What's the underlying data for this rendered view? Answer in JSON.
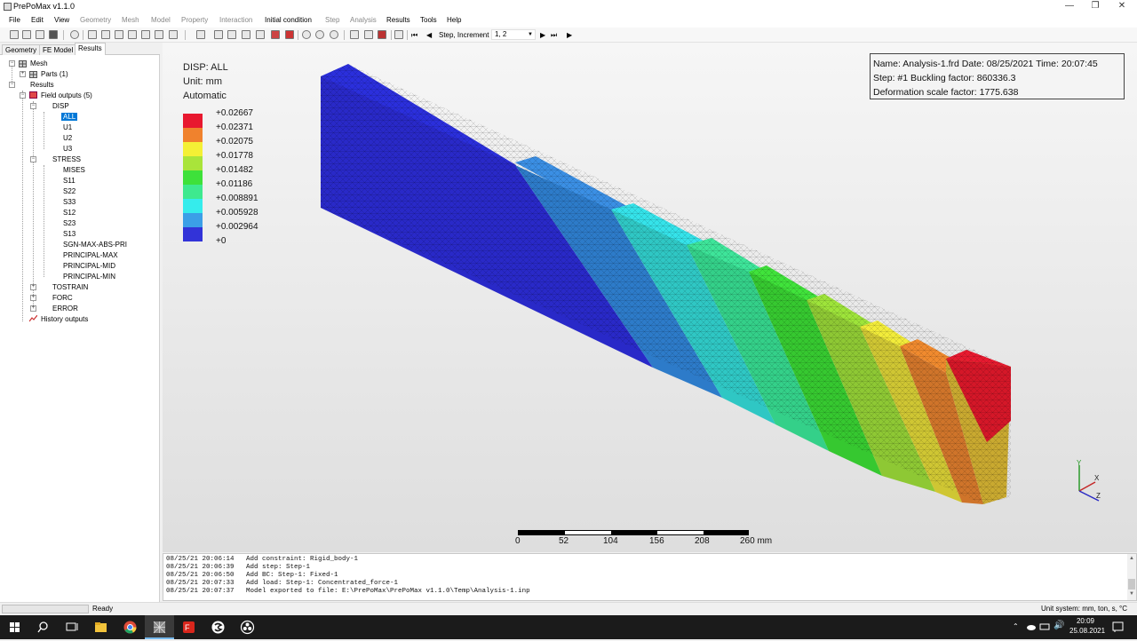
{
  "window": {
    "title": "PrePoMax v1.1.0"
  },
  "menubar": {
    "items": [
      "File",
      "Edit",
      "View",
      "Geometry",
      "Mesh",
      "Model",
      "Property",
      "Interaction",
      "Initial condition",
      "Step",
      "Analysis",
      "Results",
      "Tools",
      "Help"
    ]
  },
  "toolbar": {
    "step_increment_label": "Step, Increment",
    "step_increment_value": "1, 2"
  },
  "tabs": [
    "Geometry",
    "FE Model",
    "Results"
  ],
  "tree": {
    "mesh": "Mesh",
    "parts": "Parts (1)",
    "results": "Results",
    "field_outputs": "Field outputs (5)",
    "disp": "DISP",
    "all": "ALL",
    "u1": "U1",
    "u2": "U2",
    "u3": "U3",
    "stress": "STRESS",
    "mises": "MISES",
    "s11": "S11",
    "s22": "S22",
    "s33": "S33",
    "s12": "S12",
    "s23": "S23",
    "s13": "S13",
    "sgn": "SGN-MAX-ABS-PRI",
    "pmax": "PRINCIPAL-MAX",
    "pmid": "PRINCIPAL-MID",
    "pmin": "PRINCIPAL-MIN",
    "tostrain": "TOSTRAIN",
    "forc": "FORC",
    "error": "ERROR",
    "history": "History outputs"
  },
  "legend": {
    "title": "DISP: ALL",
    "unit": "Unit: mm",
    "mode": "Automatic",
    "values": [
      "+0.02667",
      "+0.02371",
      "+0.02075",
      "+0.01778",
      "+0.01482",
      "+0.01186",
      "+0.008891",
      "+0.005928",
      "+0.002964",
      "+0"
    ],
    "colors": [
      "#e8182f",
      "#f0822d",
      "#f4f035",
      "#a9e43a",
      "#3ee13a",
      "#3ee98f",
      "#35ecec",
      "#3b9fe7",
      "#3233d8"
    ]
  },
  "info": {
    "line1": "Name: Analysis-1.frd   Date: 08/25/2021   Time: 20:07:45",
    "line2": "Step: #1   Buckling factor: 860336.3",
    "line3": "Deformation scale factor: 1775.638"
  },
  "scalebar": {
    "ticks": [
      "0",
      "52",
      "104",
      "156",
      "208",
      "260 mm"
    ]
  },
  "axes": {
    "y": "Y",
    "x": "X",
    "z": "Z"
  },
  "console": {
    "lines": [
      "08/25/21 20:06:14   Add constraint: Rigid_body-1",
      "08/25/21 20:06:39   Add step: Step-1",
      "08/25/21 20:06:50   Add BC: Step-1: Fixed-1",
      "08/25/21 20:07:33   Add load: Step-1: Concentrated_force-1",
      "08/25/21 20:07:37   Model exported to file: E:\\PrePoMax\\PrePoMax v1.1.0\\Temp\\Analysis-1.inp"
    ]
  },
  "status": {
    "left": "Ready",
    "right": "Unit system: mm, ton, s, °C"
  },
  "taskbar": {
    "time": "20:09",
    "date": "25.08.2021"
  }
}
